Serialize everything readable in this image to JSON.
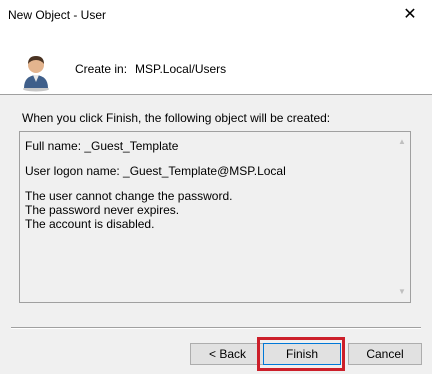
{
  "window": {
    "title": "New Object - User",
    "close_glyph": "✕"
  },
  "header": {
    "icon": "user-icon",
    "create_in_label": "Create in:",
    "create_in_path": "MSP.Local/Users"
  },
  "intro_text": "When you click Finish, the following object will be created:",
  "summary": {
    "full_name": "Full name: _Guest_Template",
    "logon_name": "User logon name: _Guest_Template@MSP.Local",
    "cannot_change": "The user cannot change the password.",
    "never_expires": "The password never expires.",
    "disabled": "The account is disabled."
  },
  "buttons": {
    "back": "< Back",
    "finish": "Finish",
    "cancel": "Cancel"
  },
  "colors": {
    "highlight": "#cc1f2a",
    "focus_border": "#0078d7"
  }
}
